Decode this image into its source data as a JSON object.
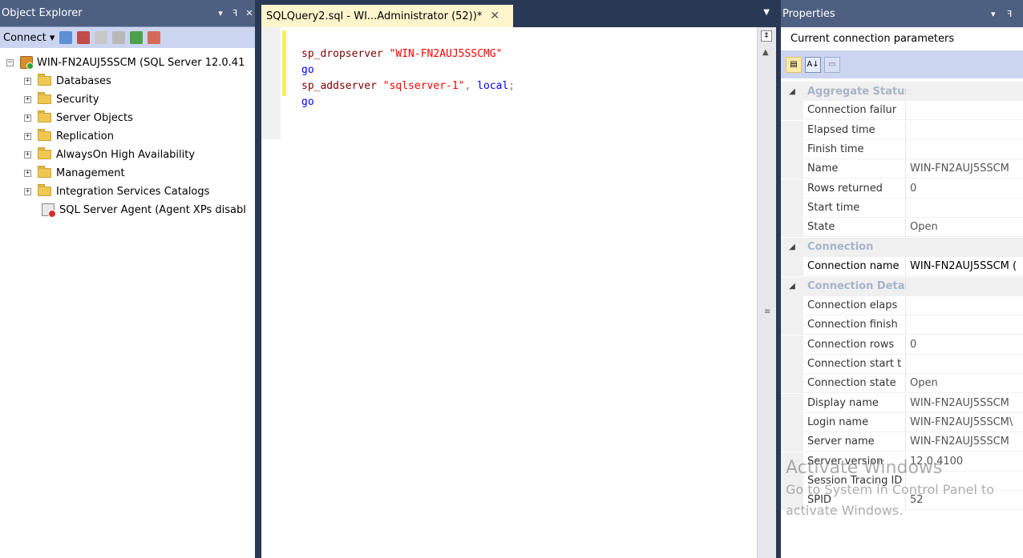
{
  "object_explorer": {
    "title": "Object Explorer",
    "pin_glyph": "▾ ꟻ",
    "close_glyph": "✕",
    "connect_label": "Connect ▾",
    "tree": {
      "root": {
        "label": "WIN-FN2AUJ5SSCM (SQL Server 12.0.41",
        "expander": "−"
      },
      "children": [
        {
          "label": "Databases",
          "expander": "+"
        },
        {
          "label": "Security",
          "expander": "+"
        },
        {
          "label": "Server Objects",
          "expander": "+"
        },
        {
          "label": "Replication",
          "expander": "+"
        },
        {
          "label": "AlwaysOn High Availability",
          "expander": "+"
        },
        {
          "label": "Management",
          "expander": "+"
        },
        {
          "label": "Integration Services Catalogs",
          "expander": "+"
        }
      ],
      "agent": {
        "label": "SQL Server Agent (Agent XPs disabl"
      }
    }
  },
  "editor": {
    "tab_title": "SQLQuery2.sql - WI...Administrator (52))*",
    "tab_close": "✕",
    "lines": [
      {
        "proc": "sp_dropserver",
        "arg": " \"WIN-FN2AUJ5SSCMG\""
      },
      {
        "kw": "go"
      },
      {
        "proc": "sp_addserver",
        "arg": " \"sqlserver-1\"",
        "sep": ", ",
        "kw2": "local",
        "end": ";"
      },
      {
        "kw": "go"
      }
    ]
  },
  "properties": {
    "title": "Properties",
    "subject": "Current connection parameters",
    "rows": [
      {
        "type": "cat",
        "name": "Aggregate Status"
      },
      {
        "name": "Connection failur",
        "value": ""
      },
      {
        "name": "Elapsed time",
        "value": ""
      },
      {
        "name": "Finish time",
        "value": ""
      },
      {
        "name": "Name",
        "value": "WIN-FN2AUJ5SSCM"
      },
      {
        "name": "Rows returned",
        "value": "0"
      },
      {
        "name": "Start time",
        "value": ""
      },
      {
        "name": "State",
        "value": "Open"
      },
      {
        "type": "cat",
        "name": "Connection"
      },
      {
        "name": "Connection name",
        "value": "WIN-FN2AUJ5SSCM (",
        "selected": true
      },
      {
        "type": "cat",
        "name": "Connection Details"
      },
      {
        "name": "Connection elaps",
        "value": ""
      },
      {
        "name": "Connection finish",
        "value": ""
      },
      {
        "name": "Connection rows",
        "value": "0"
      },
      {
        "name": "Connection start t",
        "value": ""
      },
      {
        "name": "Connection state",
        "value": "Open"
      },
      {
        "name": "Display name",
        "value": "WIN-FN2AUJ5SSCM"
      },
      {
        "name": "Login name",
        "value": "WIN-FN2AUJ5SSCM\\"
      },
      {
        "name": "Server name",
        "value": "WIN-FN2AUJ5SSCM"
      },
      {
        "name": "Server version",
        "value": "12.0.4100"
      },
      {
        "name": "Session Tracing ID",
        "value": ""
      },
      {
        "name": "SPID",
        "value": "52"
      }
    ]
  },
  "watermark": {
    "line1": "Activate Windows",
    "line2": "Go to System in Control Panel to",
    "line3": "activate Windows."
  }
}
